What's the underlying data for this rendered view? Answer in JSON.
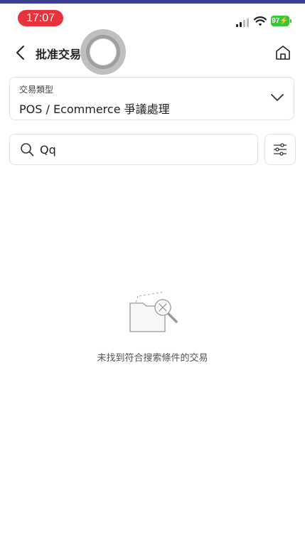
{
  "status_bar": {
    "time": "17:07",
    "battery": "97",
    "signal_icon": "cellular-signal-icon",
    "wifi_icon": "wifi-icon",
    "battery_icon": "battery-charging-icon",
    "time_pill_color": "#e8333c",
    "battery_color": "#3ac63a"
  },
  "header": {
    "title": "批准交易",
    "back_icon": "chevron-left-icon",
    "home_icon": "home-icon"
  },
  "transaction_type": {
    "label": "交易類型",
    "value": "POS / Ecommerce 爭議處理",
    "dropdown_icon": "chevron-down-icon"
  },
  "search": {
    "value": "Qq",
    "icon": "search-icon",
    "filter_icon": "filter-sliders-icon"
  },
  "empty_state": {
    "icon": "empty-folder-search-icon",
    "message": "未找到符合搜索條件的交易"
  },
  "colors": {
    "top_accent": "#3a3f8f",
    "border": "#e2e2e2",
    "text": "#1f1f1f"
  }
}
